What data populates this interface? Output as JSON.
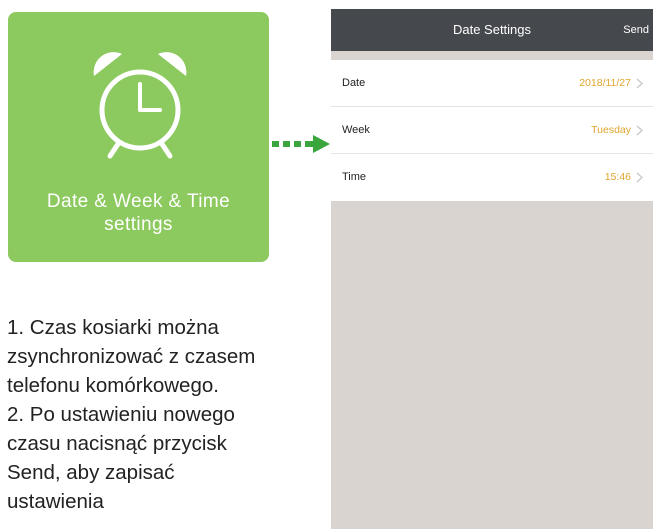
{
  "tile": {
    "icon": "alarm-clock-icon",
    "caption_line1": "Date & Week & Time",
    "caption_line2": "settings",
    "background": "#8cc95f"
  },
  "arrow": {
    "icon": "dashed-arrow-right-icon",
    "color": "#3aa53d"
  },
  "instructions": {
    "lines": [
      "1. Czas kosiarki można",
      "zsynchronizować z czasem",
      "telefonu komórkowego.",
      "2. Po ustawieniu nowego",
      "czasu nacisnąć przycisk",
      "Send, aby zapisać",
      "ustawienia"
    ]
  },
  "phone": {
    "nav": {
      "title": "Date Settings",
      "send_label": "Send",
      "background": "#45484c"
    },
    "settings": [
      {
        "label": "Date",
        "value": "2018/11/27"
      },
      {
        "label": "Week",
        "value": "Tuesday"
      },
      {
        "label": "Time",
        "value": "15:46"
      }
    ],
    "value_color": "#e0a52f",
    "background": "#d9d4cf"
  }
}
